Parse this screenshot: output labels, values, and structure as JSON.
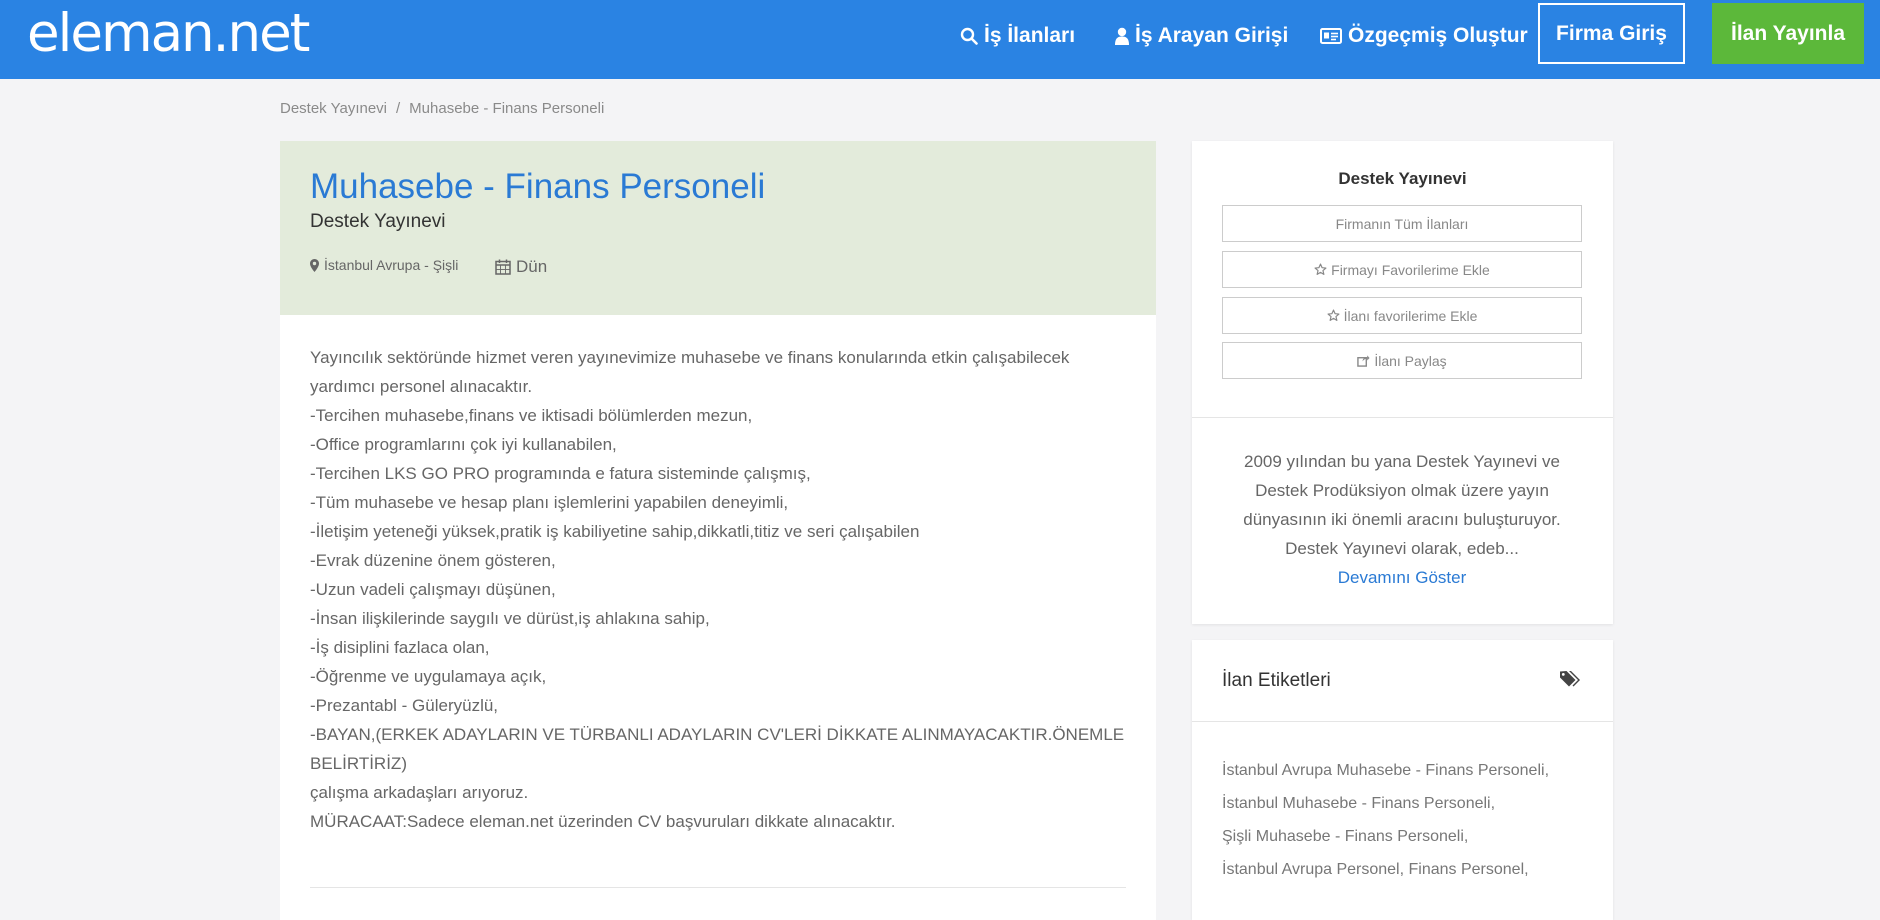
{
  "header": {
    "logo": "eleman.net",
    "nav": {
      "jobs": "İş İlanları",
      "seeker_login": "İş Arayan Girişi",
      "create_cv": "Özgeçmiş Oluştur",
      "company_login": "Firma Giriş",
      "post_job": "İlan Yayınla"
    }
  },
  "breadcrumb": {
    "company": "Destek Yayınevi",
    "separator": "/",
    "current": "Muhasebe - Finans Personeli"
  },
  "job": {
    "title": "Muhasebe - Finans Personeli",
    "company": "Destek Yayınevi",
    "location": "İstanbul Avrupa - Şişli",
    "date": "Dün",
    "description": [
      "Yayıncılık sektöründe hizmet veren yayınevimize muhasebe ve finans konularında etkin çalışabilecek yardımcı personel alınacaktır.",
      "-Tercihen muhasebe,finans ve iktisadi bölümlerden mezun,",
      "-Office programlarını çok iyi kullanabilen,",
      "-Tercihen LKS GO PRO programında e fatura sisteminde çalışmış,",
      "-Tüm muhasebe ve hesap planı işlemlerini yapabilen deneyimli,",
      "-İletişim yeteneği yüksek,pratik iş kabiliyetine sahip,dikkatli,titiz ve seri çalışabilen",
      "-Evrak düzenine önem gösteren,",
      "-Uzun vadeli çalışmayı düşünen,",
      "-İnsan ilişkilerinde saygılı ve dürüst,iş ahlakına sahip,",
      "-İş disiplini fazlaca olan,",
      "-Öğrenme ve uygulamaya açık,",
      "-Prezantabl - Güleryüzlü,",
      "-BAYAN,(ERKEK ADAYLARIN VE TÜRBANLI ADAYLARIN CV'LERİ DİKKATE ALINMAYACAKTIR.ÖNEMLE BELİRTİRİZ)",
      "çalışma arkadaşları arıyoruz.",
      "MÜRACAAT:Sadece eleman.net üzerinden CV başvuruları dikkate alınacaktır."
    ]
  },
  "sidebar": {
    "company_name": "Destek Yayınevi",
    "buttons": {
      "all_jobs": "Firmanın Tüm İlanları",
      "fav_company": "Firmayı Favorilerime Ekle",
      "fav_job": "İlanı favorilerime Ekle",
      "share": "İlanı Paylaş"
    },
    "about": "2009 yılından bu yana Destek Yayınevi ve Destek Prodüksiyon olmak üzere yayın dünyasının iki önemli aracını buluşturuyor. Destek Yayınevi olarak, edeb...",
    "show_more": "Devamını Göster"
  },
  "tags": {
    "title": "İlan Etiketleri",
    "items": [
      "İstanbul Avrupa Muhasebe - Finans Personeli,",
      "İstanbul Muhasebe - Finans Personeli,",
      "Şişli Muhasebe - Finans Personeli,",
      "İstanbul Avrupa Personel,",
      "Finans Personel,"
    ]
  },
  "colors": {
    "header_bg": "#2a83e3",
    "post_job_bg": "#5cb83a",
    "title_blue": "#2a7ad4",
    "job_head_bg": "#e3ebdb"
  }
}
